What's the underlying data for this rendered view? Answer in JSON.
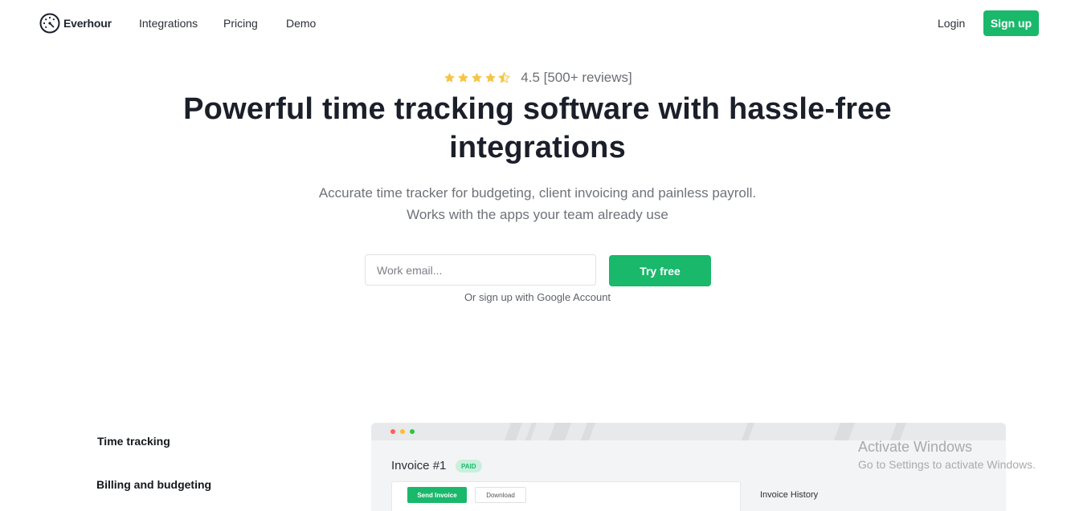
{
  "nav": {
    "brand": "Everhour",
    "links": [
      "Integrations",
      "Pricing",
      "Demo"
    ],
    "login": "Login",
    "signup": "Sign up"
  },
  "hero": {
    "rating_value": 4.5,
    "rating_text": "4.5 [500+ reviews]",
    "title": "Powerful time tracking software with hassle-free integrations",
    "subtitle_line1": "Accurate time tracker for budgeting, client invoicing and painless payroll.",
    "subtitle_line2": "Works with the apps your team already use"
  },
  "signup_form": {
    "email_placeholder": "Work email...",
    "email_value": "",
    "submit_label": "Try free",
    "google_link": "Or sign up with Google Account"
  },
  "features": [
    "Time tracking",
    "Billing and budgeting"
  ],
  "preview": {
    "invoice_title": "Invoice #1",
    "status_badge": "PAID",
    "send_button": "Send Invoice",
    "download_button": "Download",
    "history_label": "Invoice History"
  },
  "os_watermark": {
    "title": "Activate Windows",
    "subtitle": "Go to Settings to activate Windows."
  },
  "colors": {
    "brand_green": "#19b86b",
    "star_yellow": "#f6c445",
    "heading": "#1b1f2a",
    "muted_text": "#6e7278"
  },
  "icons": {
    "logo": "clock-logo-icon",
    "rating": "star-icon"
  }
}
